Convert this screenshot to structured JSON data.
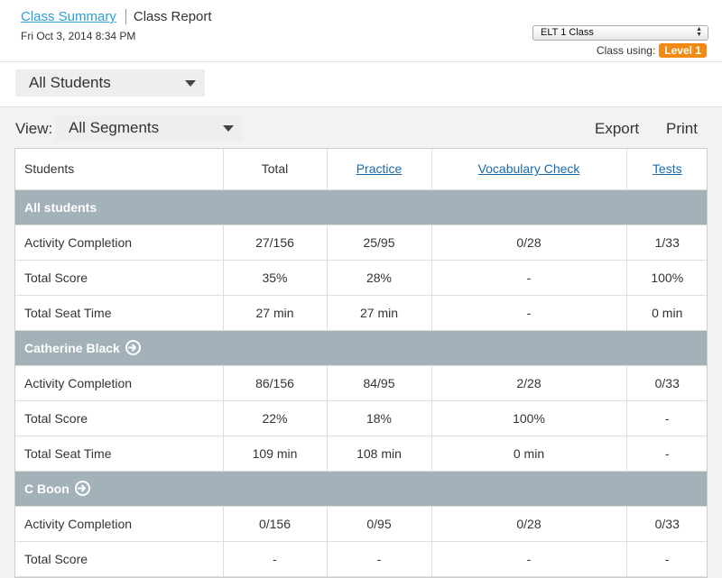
{
  "header": {
    "breadcrumb_link": "Class Summary",
    "breadcrumb_current": "Class Report",
    "date": "Fri Oct 3, 2014 8:34 PM",
    "class_select": "ELT 1 Class",
    "class_using_label": "Class using:",
    "level_badge": "Level 1"
  },
  "filters": {
    "students_dropdown": "All Students",
    "view_label": "View:",
    "segments_dropdown": "All Segments",
    "export_label": "Export",
    "print_label": "Print"
  },
  "table": {
    "columns": [
      "Students",
      "Total",
      "Practice",
      "Vocabulary Check",
      "Tests"
    ],
    "groups": [
      {
        "name": "All students",
        "rows": [
          {
            "label": "Activity Completion",
            "values": [
              "27/156",
              "25/95",
              "0/28",
              "1/33"
            ]
          },
          {
            "label": "Total Score",
            "values": [
              "35%",
              "28%",
              "-",
              "100%"
            ]
          },
          {
            "label": "Total Seat Time",
            "values": [
              "27 min",
              "27 min",
              "-",
              "0 min"
            ]
          }
        ]
      },
      {
        "name": "Catherine Black",
        "rows": [
          {
            "label": "Activity Completion",
            "values": [
              "86/156",
              "84/95",
              "2/28",
              "0/33"
            ]
          },
          {
            "label": "Total Score",
            "values": [
              "22%",
              "18%",
              "100%",
              "-"
            ]
          },
          {
            "label": "Total Seat Time",
            "values": [
              "109 min",
              "108 min",
              "0 min",
              "-"
            ]
          }
        ]
      },
      {
        "name": "C Boon",
        "rows": [
          {
            "label": "Activity Completion",
            "values": [
              "0/156",
              "0/95",
              "0/28",
              "0/33"
            ]
          },
          {
            "label": "Total Score",
            "values": [
              "-",
              "-",
              "-",
              "-"
            ]
          }
        ]
      }
    ]
  },
  "colors": {
    "link": "#2a9fd6",
    "badge": "#f08a14",
    "group_row": "#a3b1b8"
  }
}
